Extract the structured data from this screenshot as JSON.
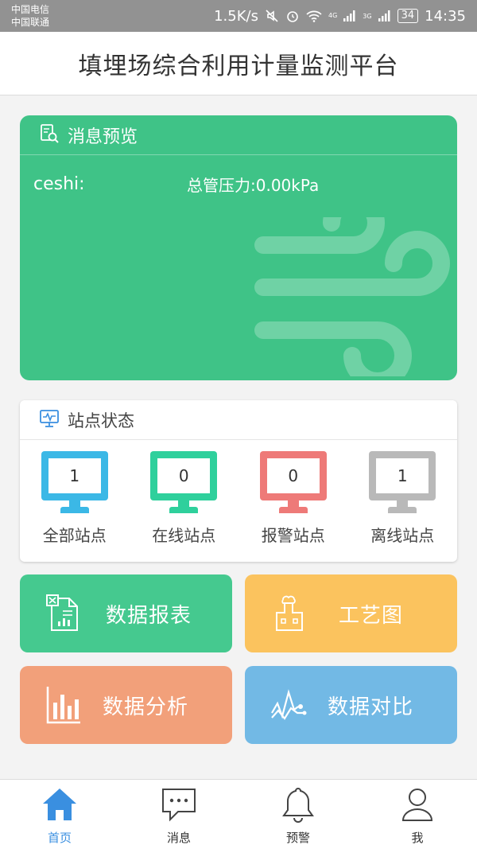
{
  "status_bar": {
    "carrier1": "中国电信",
    "carrier2": "中国联通",
    "net_speed": "1.5K/s",
    "network_label": "4G",
    "network_label2": "3G",
    "battery": "34",
    "time": "14:35"
  },
  "header": {
    "title": "填埋场综合利用计量监测平台"
  },
  "message_card": {
    "title": "消息预览",
    "station_name": "ceshi:",
    "reading": "总管压力:0.00kPa",
    "bg_color": "#3fc387"
  },
  "station_status": {
    "title": "站点状态",
    "items": [
      {
        "label": "全部站点",
        "count": "1",
        "color": "#3bb8e6"
      },
      {
        "label": "在线站点",
        "count": "0",
        "color": "#2fd09c"
      },
      {
        "label": "报警站点",
        "count": "0",
        "color": "#ee7a78"
      },
      {
        "label": "离线站点",
        "count": "1",
        "color": "#b9b9b9"
      }
    ]
  },
  "tiles": [
    {
      "label": "数据报表",
      "icon": "spreadsheet-report-icon",
      "color": "#45c98f"
    },
    {
      "label": "工艺图",
      "icon": "factory-icon",
      "color": "#fbc35e"
    },
    {
      "label": "数据分析",
      "icon": "bar-chart-icon",
      "color": "#f2a07a"
    },
    {
      "label": "数据对比",
      "icon": "line-compare-icon",
      "color": "#72b9e5"
    }
  ],
  "tabbar": {
    "items": [
      {
        "label": "首页",
        "icon": "home-icon",
        "active": true
      },
      {
        "label": "消息",
        "icon": "chat-bubble-icon",
        "active": false
      },
      {
        "label": "预警",
        "icon": "bell-icon",
        "active": false
      },
      {
        "label": "我",
        "icon": "user-icon",
        "active": false
      }
    ],
    "active_color": "#3a8fe0"
  }
}
